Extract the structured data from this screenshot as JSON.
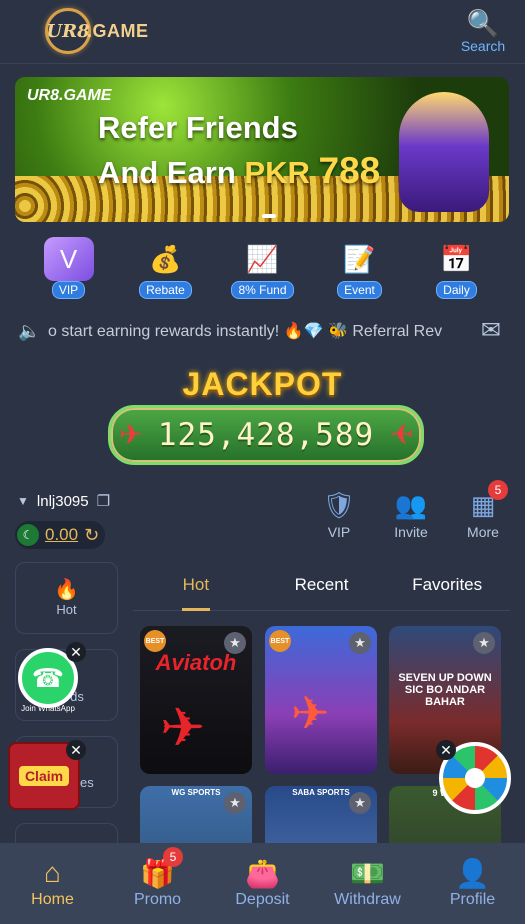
{
  "header": {
    "logo_text": ".GAME",
    "logo_mark": "UR8",
    "search_label": "Search"
  },
  "banner": {
    "logo": "UR8.GAME",
    "line1": "Refer Friends",
    "line2_prefix": "And Earn",
    "currency": "PKR",
    "amount": "788"
  },
  "quick_links": [
    {
      "label": "VIP",
      "icon": "vip-crown-icon"
    },
    {
      "label": "Rebate",
      "icon": "coins-icon"
    },
    {
      "label": "8% Fund",
      "icon": "fund-growth-icon"
    },
    {
      "label": "Event",
      "icon": "event-note-icon"
    },
    {
      "label": "Daily",
      "icon": "daily-calendar-icon"
    }
  ],
  "marquee": {
    "text": "o start earning rewards instantly! 🔥💎   🐝 Referral Rev"
  },
  "jackpot": {
    "title": "JACKPOT",
    "value": "125,428,589"
  },
  "user": {
    "name": "lnlj3095",
    "balance": "0.00",
    "actions": [
      {
        "label": "VIP",
        "icon": "vip-shield-icon"
      },
      {
        "label": "Invite",
        "icon": "invite-people-icon"
      },
      {
        "label": "More",
        "icon": "more-grid-icon",
        "badge": "5"
      }
    ]
  },
  "categories": [
    {
      "label": "Hot",
      "icon": "fire-icon"
    },
    {
      "label": "Cards",
      "icon": "cards-icon"
    },
    {
      "label": "mes",
      "icon": "games-icon"
    },
    {
      "label": "",
      "icon": "blank-icon"
    }
  ],
  "tabs": [
    "Hot",
    "Recent",
    "Favorites"
  ],
  "games": [
    {
      "title": "Aviatoh",
      "provider": ""
    },
    {
      "title": "",
      "provider": ""
    },
    {
      "title": "SEVEN UP DOWN  SIC BO  ANDAR BAHAR",
      "provider": ""
    },
    {
      "title": "",
      "provider": "WG SPORTS"
    },
    {
      "title": "",
      "provider": "SABA SPORTS"
    },
    {
      "title": "",
      "provider": "9 WIC"
    }
  ],
  "widgets": {
    "whatsapp_label": "Join WhatsApp",
    "claim_label": "Claim",
    "spin_label": "Spin"
  },
  "bottom_nav": [
    {
      "label": "Home",
      "icon": "home-icon"
    },
    {
      "label": "Promo",
      "icon": "gift-icon",
      "badge": "5"
    },
    {
      "label": "Deposit",
      "icon": "wallet-icon"
    },
    {
      "label": "Withdraw",
      "icon": "cash-icon"
    },
    {
      "label": "Profile",
      "icon": "profile-icon"
    }
  ],
  "colors": {
    "background": "#2b3344",
    "accent_gold": "#e4b85a",
    "accent_blue": "#6fb6ff",
    "badge_red": "#e63b3b"
  }
}
